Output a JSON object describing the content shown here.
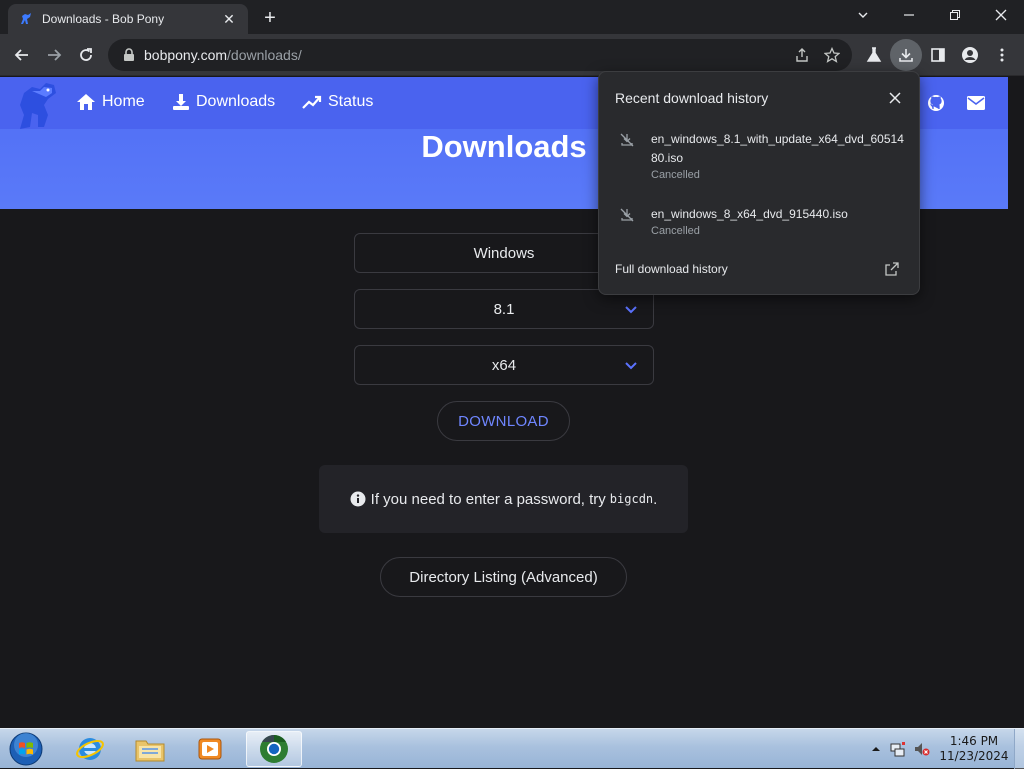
{
  "browser": {
    "tab_title": "Downloads - Bob Pony",
    "url_host": "bobpony.com",
    "url_path": "/downloads/"
  },
  "site": {
    "nav": {
      "home": "Home",
      "downloads": "Downloads",
      "status": "Status"
    },
    "page_title": "Downloads",
    "selects": {
      "os": "Windows",
      "version": "8.1",
      "arch": "x64"
    },
    "download_label": "DOWNLOAD",
    "info_text": "If you need to enter a password, try",
    "info_code": "bigcdn",
    "info_suffix": ".",
    "directory_label": "Directory Listing (Advanced)"
  },
  "downloads_popup": {
    "title": "Recent download history",
    "items": [
      {
        "name": "en_windows_8.1_with_update_x64_dvd_6051480.iso",
        "status": "Cancelled"
      },
      {
        "name": "en_windows_8_x64_dvd_915440.iso",
        "status": "Cancelled"
      }
    ],
    "full_history_label": "Full download history"
  },
  "taskbar": {
    "time": "1:46 PM",
    "date": "11/23/2024"
  },
  "colors": {
    "accent": "#4a63ef",
    "link_blue": "#6f86ff"
  }
}
